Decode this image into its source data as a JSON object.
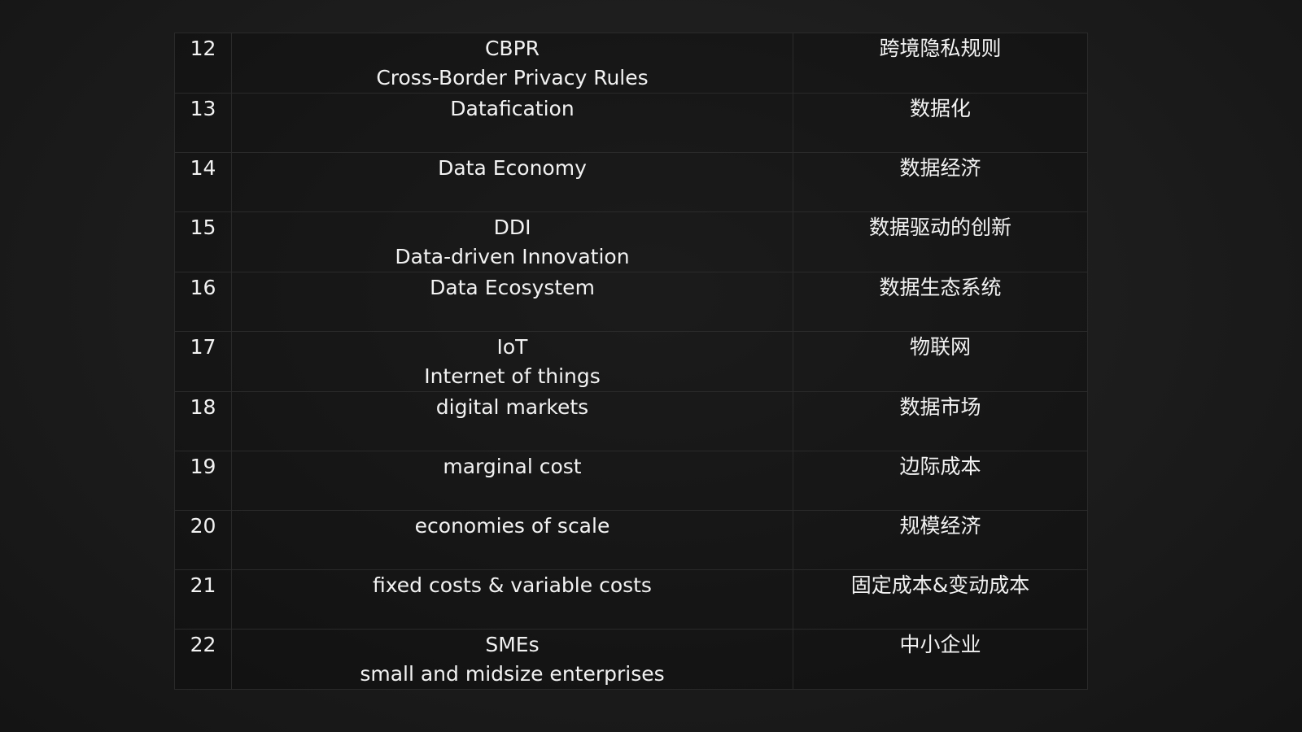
{
  "rows": [
    {
      "num": "12",
      "en": [
        "CBPR",
        "Cross-Border Privacy Rules"
      ],
      "zh": "跨境隐私规则"
    },
    {
      "num": "13",
      "en": [
        "Datafication"
      ],
      "zh": "数据化"
    },
    {
      "num": "14",
      "en": [
        "Data Economy"
      ],
      "zh": "数据经济"
    },
    {
      "num": "15",
      "en": [
        "DDI",
        "Data-driven Innovation"
      ],
      "zh": "数据驱动的创新"
    },
    {
      "num": "16",
      "en": [
        "Data Ecosystem"
      ],
      "zh": "数据生态系统"
    },
    {
      "num": "17",
      "en": [
        "IoT",
        "Internet of things"
      ],
      "zh": "物联网"
    },
    {
      "num": "18",
      "en": [
        "digital markets"
      ],
      "zh": "数据市场"
    },
    {
      "num": "19",
      "en": [
        "marginal cost"
      ],
      "zh": "边际成本"
    },
    {
      "num": "20",
      "en": [
        "economies of scale"
      ],
      "zh": "规模经济"
    },
    {
      "num": "21",
      "en": [
        "fixed costs & variable costs"
      ],
      "zh": "固定成本&变动成本"
    },
    {
      "num": "22",
      "en": [
        "SMEs",
        "small and midsize enterprises"
      ],
      "zh": "中小企业"
    }
  ]
}
